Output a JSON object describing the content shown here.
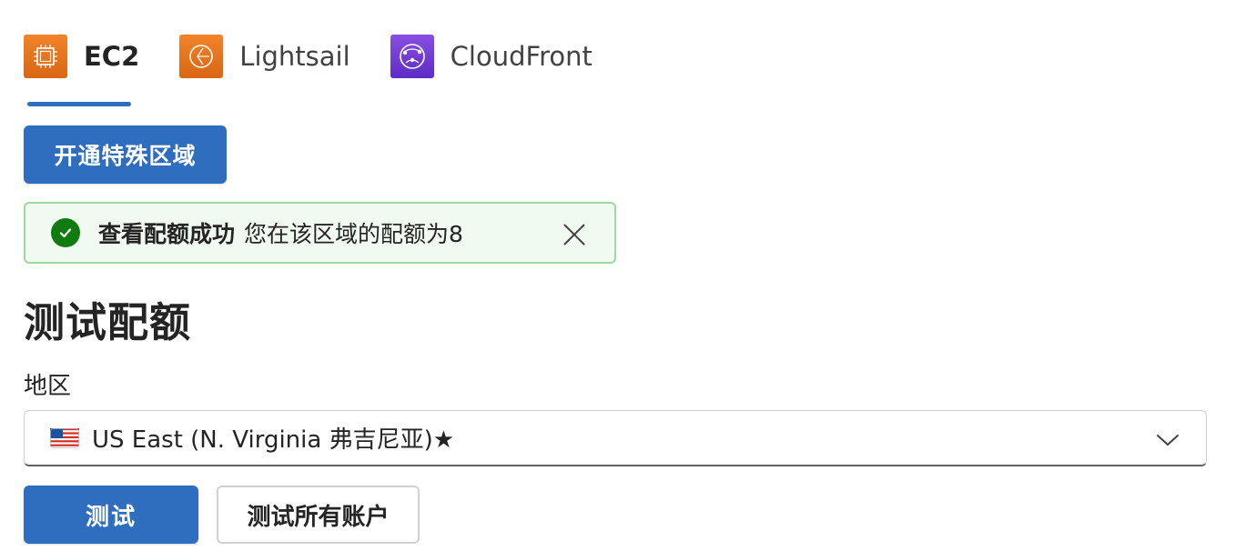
{
  "tabs": [
    {
      "label": "EC2",
      "icon": "ec2-icon",
      "active": true
    },
    {
      "label": "Lightsail",
      "icon": "lightsail-icon",
      "active": false
    },
    {
      "label": "CloudFront",
      "icon": "cloudfront-icon",
      "active": false
    }
  ],
  "actions": {
    "open_special_region_label": "开通特殊区域"
  },
  "message": {
    "title": "查看配额成功",
    "text": "您在该区域的配额为8",
    "status": "success"
  },
  "section": {
    "heading": "测试配额"
  },
  "region": {
    "label": "地区",
    "selected": "US East (N. Virginia 弗吉尼亚)★",
    "flag_icon": "us-flag-icon"
  },
  "buttons": {
    "test_label": "测试",
    "test_all_label": "测试所有账户"
  },
  "colors": {
    "accent": "#2f6dbf",
    "success": "#107c10",
    "success_bg": "#f1faf1",
    "success_border": "#9fd89f",
    "aws_orange": "#e8781f",
    "cloudfront_purple": "#7040d8"
  }
}
